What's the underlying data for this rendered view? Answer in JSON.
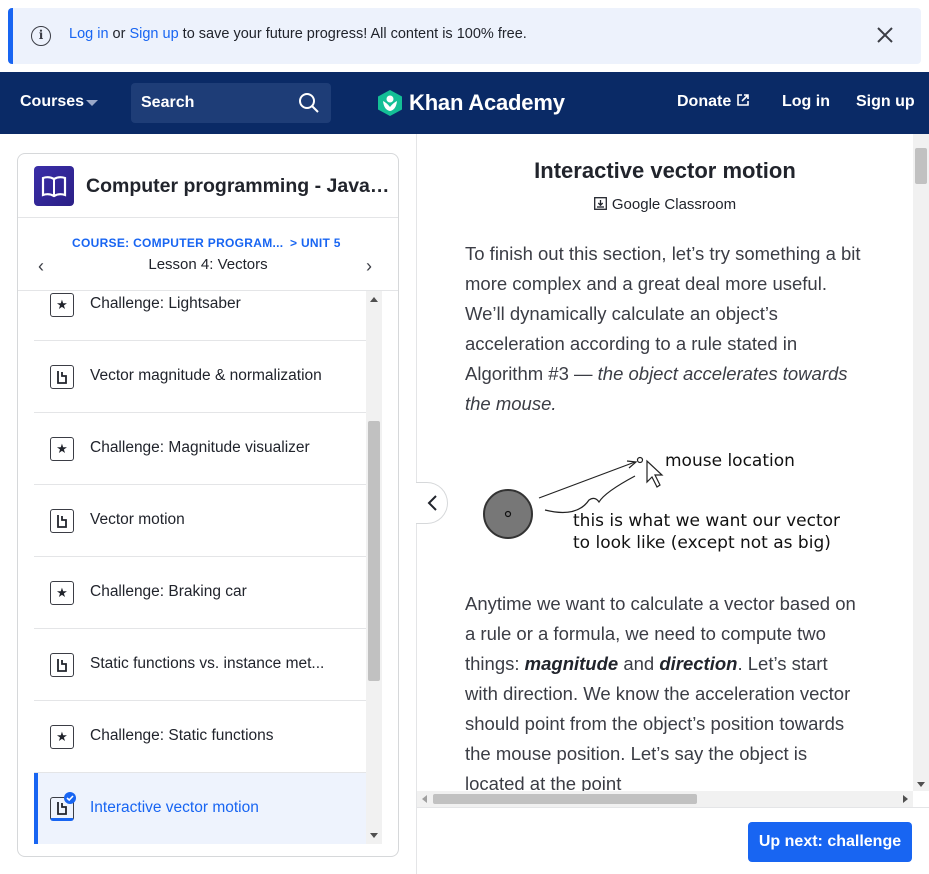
{
  "banner": {
    "login": "Log in",
    "or": " or ",
    "signup": "Sign up",
    "rest": " to save your future progress! All content is 100% free."
  },
  "nav": {
    "courses": "Courses",
    "search": "Search",
    "brand": "Khan Academy",
    "donate": "Donate",
    "login": "Log in",
    "signup": "Sign up"
  },
  "sidebar": {
    "course_title": "Computer programming - JavaScript and the web",
    "crumb_course": "COURSE: COMPUTER PROGRAM...",
    "crumb_unit": "> UNIT 5",
    "lesson": "Lesson 4: Vectors",
    "items": [
      {
        "label": "Challenge: Lightsaber",
        "type": "challenge"
      },
      {
        "label": "Vector magnitude & normalization",
        "type": "article"
      },
      {
        "label": "Challenge: Magnitude visualizer",
        "type": "challenge"
      },
      {
        "label": "Vector motion",
        "type": "article"
      },
      {
        "label": "Challenge: Braking car",
        "type": "challenge"
      },
      {
        "label": "Static functions vs. instance met...",
        "type": "article"
      },
      {
        "label": "Challenge: Static functions",
        "type": "challenge"
      },
      {
        "label": "Interactive vector motion",
        "type": "article",
        "active": true
      }
    ]
  },
  "article": {
    "title": "Interactive vector motion",
    "classroom": "Google Classroom",
    "p1_a": "To finish out this section, let’s try something a bit more complex and a great deal more useful. We’ll dynamically calculate an object’s acceleration according to a rule stated in Algorithm #3 — ",
    "p1_em": "the object accelerates towards the mouse.",
    "diagram": {
      "mouse_label": "mouse location",
      "vector_line1": "this is what we want our vector",
      "vector_line2": "to look like (except not as big)"
    },
    "p2_a": "Anytime we want to calculate a vector based on a rule or a formula, we need to compute two things: ",
    "p2_b1": "magnitude",
    "p2_and": " and ",
    "p2_b2": "direction",
    "p2_c": ". Let’s start with direction. We know the acceleration vector should point from the object’s position towards the mouse position. Let’s say the object is located at the point"
  },
  "footer": {
    "upnext": "Up next: challenge"
  },
  "colors": {
    "brand_blue": "#1865f2",
    "nav_bg": "#0a2a66",
    "logo_green": "#14bf96"
  }
}
